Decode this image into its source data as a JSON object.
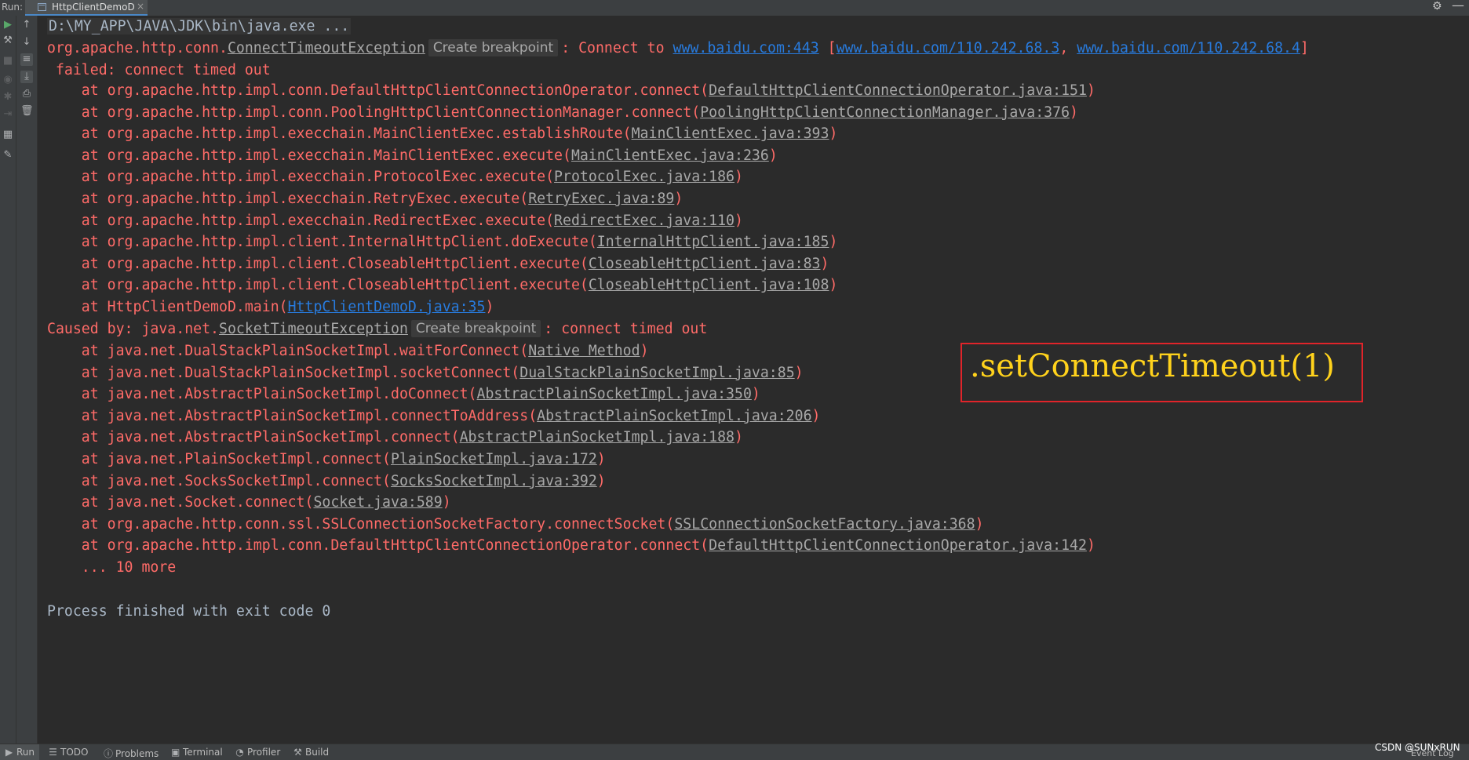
{
  "run_panel": {
    "label": "Run:",
    "tab_title": "HttpClientDemoD"
  },
  "icons": {
    "settings": "gear-icon",
    "minimize": "minimize-icon",
    "rerun": "play-icon",
    "stop": "stop-icon"
  },
  "console": {
    "command": "D:\\MY_APP\\JAVA\\JDK\\bin\\java.exe ...",
    "create_breakpoint": "Create breakpoint",
    "exc1": {
      "prefix": "org.apache.http.conn.",
      "class": "ConnectTimeoutException",
      "msg": ": Connect to ",
      "host": "www.baidu.com:443",
      "open": " [",
      "addr1": "www.baidu.com/110.242.68.3",
      "sep": ", ",
      "addr2": "www.baidu.com/110.242.68.4",
      "close": "]",
      "cont": " failed: connect timed out"
    },
    "frames1": [
      {
        "method": "    at org.apache.http.impl.conn.DefaultHttpClientConnectionOperator.connect(",
        "loc": "DefaultHttpClientConnectionOperator.java:151",
        "end": ")"
      },
      {
        "method": "    at org.apache.http.impl.conn.PoolingHttpClientConnectionManager.connect(",
        "loc": "PoolingHttpClientConnectionManager.java:376",
        "end": ")"
      },
      {
        "method": "    at org.apache.http.impl.execchain.MainClientExec.establishRoute(",
        "loc": "MainClientExec.java:393",
        "end": ")"
      },
      {
        "method": "    at org.apache.http.impl.execchain.MainClientExec.execute(",
        "loc": "MainClientExec.java:236",
        "end": ")"
      },
      {
        "method": "    at org.apache.http.impl.execchain.ProtocolExec.execute(",
        "loc": "ProtocolExec.java:186",
        "end": ")"
      },
      {
        "method": "    at org.apache.http.impl.execchain.RetryExec.execute(",
        "loc": "RetryExec.java:89",
        "end": ")"
      },
      {
        "method": "    at org.apache.http.impl.execchain.RedirectExec.execute(",
        "loc": "RedirectExec.java:110",
        "end": ")"
      },
      {
        "method": "    at org.apache.http.impl.client.InternalHttpClient.doExecute(",
        "loc": "InternalHttpClient.java:185",
        "end": ")"
      },
      {
        "method": "    at org.apache.http.impl.client.CloseableHttpClient.execute(",
        "loc": "CloseableHttpClient.java:83",
        "end": ")"
      },
      {
        "method": "    at org.apache.http.impl.client.CloseableHttpClient.execute(",
        "loc": "CloseableHttpClient.java:108",
        "end": ")"
      },
      {
        "method": "    at HttpClientDemoD.main(",
        "loc": "HttpClientDemoD.java:35",
        "end": ")"
      }
    ],
    "exc2": {
      "prefix": "Caused by: java.net.",
      "class": "SocketTimeoutException",
      "msg": ": connect timed out"
    },
    "frames2": [
      {
        "method": "    at java.net.DualStackPlainSocketImpl.waitForConnect(",
        "loc": "Native Method",
        "end": ")"
      },
      {
        "method": "    at java.net.DualStackPlainSocketImpl.socketConnect(",
        "loc": "DualStackPlainSocketImpl.java:85",
        "end": ")"
      },
      {
        "method": "    at java.net.AbstractPlainSocketImpl.doConnect(",
        "loc": "AbstractPlainSocketImpl.java:350",
        "end": ")"
      },
      {
        "method": "    at java.net.AbstractPlainSocketImpl.connectToAddress(",
        "loc": "AbstractPlainSocketImpl.java:206",
        "end": ")"
      },
      {
        "method": "    at java.net.AbstractPlainSocketImpl.connect(",
        "loc": "AbstractPlainSocketImpl.java:188",
        "end": ")"
      },
      {
        "method": "    at java.net.PlainSocketImpl.connect(",
        "loc": "PlainSocketImpl.java:172",
        "end": ")"
      },
      {
        "method": "    at java.net.SocksSocketImpl.connect(",
        "loc": "SocksSocketImpl.java:392",
        "end": ")"
      },
      {
        "method": "    at java.net.Socket.connect(",
        "loc": "Socket.java:589",
        "end": ")"
      },
      {
        "method": "    at org.apache.http.conn.ssl.SSLConnectionSocketFactory.connectSocket(",
        "loc": "SSLConnectionSocketFactory.java:368",
        "end": ")"
      },
      {
        "method": "    at org.apache.http.impl.conn.DefaultHttpClientConnectionOperator.connect(",
        "loc": "DefaultHttpClientConnectionOperator.java:142",
        "end": ")"
      }
    ],
    "more": "    ... 10 more",
    "finished": "Process finished with exit code 0"
  },
  "annotation": ".setConnectTimeout(1)",
  "bottom_bar": {
    "run": "Run",
    "todo": "TODO",
    "problems": "Problems",
    "terminal": "Terminal",
    "profiler": "Profiler",
    "build": "Build",
    "event_log": "Event Log"
  },
  "watermark": "CSDN @SUNxRUN",
  "colors": {
    "background": "#2b2b2b",
    "error_text": "#ff6b68",
    "link_blue": "#287bde",
    "annotation_border": "#e0242a",
    "annotation_text": "#ffd21c"
  }
}
